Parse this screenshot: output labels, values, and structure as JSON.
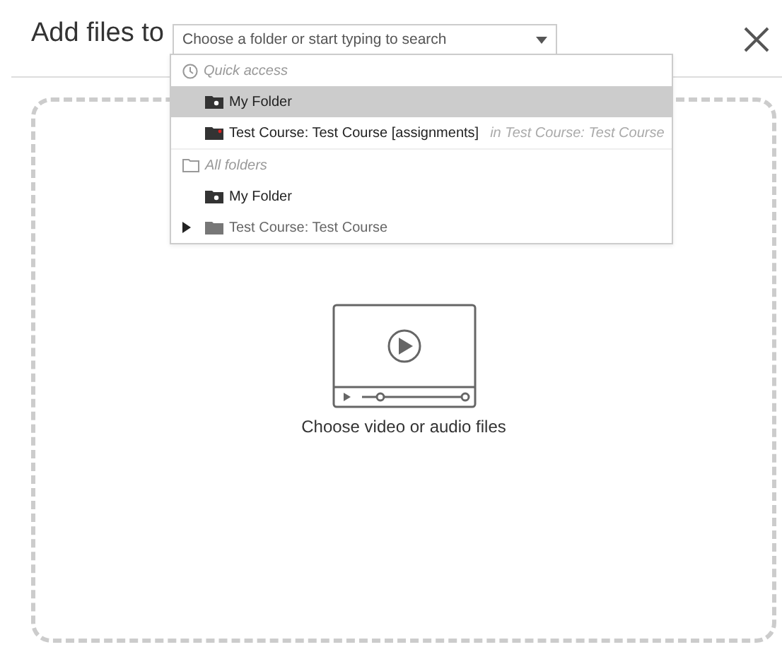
{
  "header": {
    "title": "Add files to",
    "folder_select": {
      "placeholder": "Choose a folder or start typing to search",
      "open": true
    }
  },
  "dropdown": {
    "sections": [
      {
        "label": "Quick access",
        "kind": "recent",
        "items": [
          {
            "label": "My Folder",
            "kind": "personal",
            "selected": true
          },
          {
            "label": "Test Course: Test Course [assignments]",
            "context": "in Test Course: Test Course",
            "kind": "assignments",
            "selected": false
          }
        ]
      },
      {
        "label": "All folders",
        "kind": "tree",
        "items": [
          {
            "label": "My Folder",
            "kind": "personal",
            "selected": false
          },
          {
            "label": "Test Course: Test Course",
            "kind": "course",
            "selected": false,
            "expanded": false
          }
        ]
      }
    ]
  },
  "dropzone": {
    "label": "Choose video or audio files"
  }
}
